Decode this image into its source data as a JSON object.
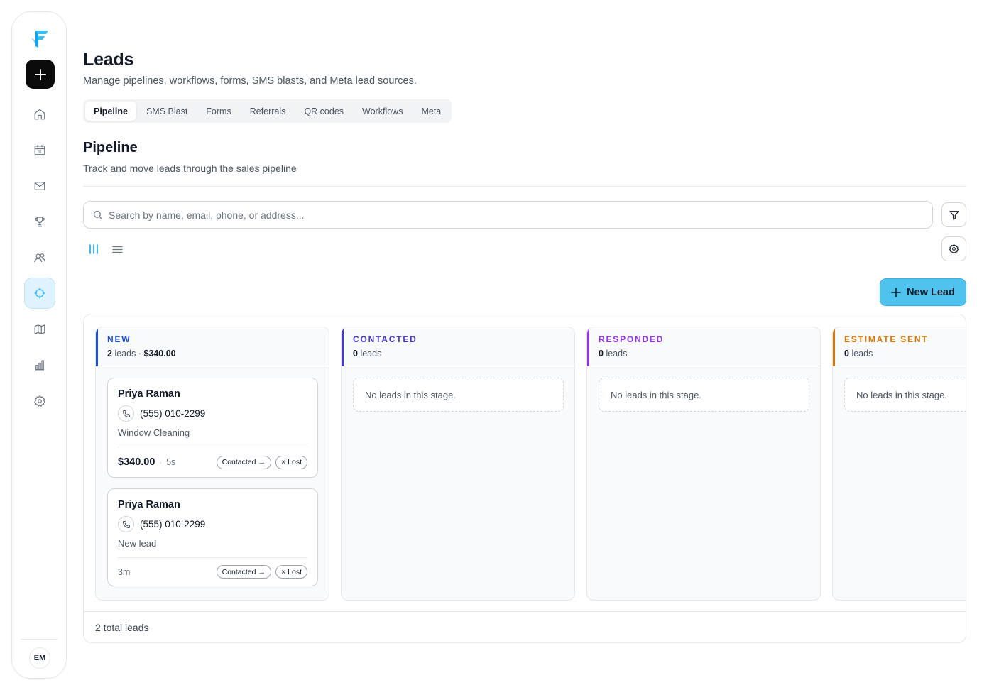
{
  "sidebar": {
    "avatar_initials": "EM",
    "nav_icons": [
      "home-icon",
      "calendar-icon",
      "mail-icon",
      "trophy-icon",
      "users-icon",
      "crosshair-icon",
      "map-icon",
      "bar-chart-icon",
      "settings-icon"
    ],
    "active_icon": "crosshair-icon",
    "accent": "#38bdf8"
  },
  "header": {
    "title": "Leads",
    "subtitle": "Manage pipelines, workflows, forms, SMS blasts, and Meta lead sources."
  },
  "tabs": [
    {
      "label": "Pipeline",
      "active": true
    },
    {
      "label": "SMS Blast"
    },
    {
      "label": "Forms"
    },
    {
      "label": "Referrals"
    },
    {
      "label": "QR codes"
    },
    {
      "label": "Workflows"
    },
    {
      "label": "Meta"
    }
  ],
  "pipeline": {
    "title": "Pipeline",
    "subtitle": "Track and move leads through the sales pipeline"
  },
  "search": {
    "placeholder": "Search by name, email, phone, or address...",
    "value": ""
  },
  "actions": {
    "new_lead_label": "New Lead"
  },
  "columns": [
    {
      "name": "NEW",
      "count": "2",
      "count_label": "leads",
      "total": "$340.00",
      "color": "#1d4ed8",
      "empty_text": "",
      "cards": [
        {
          "name": "Priya Raman",
          "phone": "(555) 010-2299",
          "service": "Window Cleaning",
          "price": "$340.00",
          "age": "5s",
          "move_label": "Contacted",
          "lost_label": "Lost"
        },
        {
          "name": "Priya Raman",
          "phone": "(555) 010-2299",
          "service": "New lead",
          "price": "",
          "age": "3m",
          "move_label": "Contacted",
          "lost_label": "Lost"
        }
      ]
    },
    {
      "name": "CONTACTED",
      "count": "0",
      "count_label": "leads",
      "color": "#4338ca",
      "empty_text": "No leads in this stage.",
      "cards": []
    },
    {
      "name": "RESPONDED",
      "count": "0",
      "count_label": "leads",
      "color": "#9333ea",
      "empty_text": "No leads in this stage.",
      "cards": []
    },
    {
      "name": "ESTIMATE SENT",
      "count": "0",
      "count_label": "leads",
      "color": "#d97706",
      "empty_text": "No leads in this stage.",
      "cards": []
    }
  ],
  "footer": {
    "total_label": "2 total leads"
  }
}
